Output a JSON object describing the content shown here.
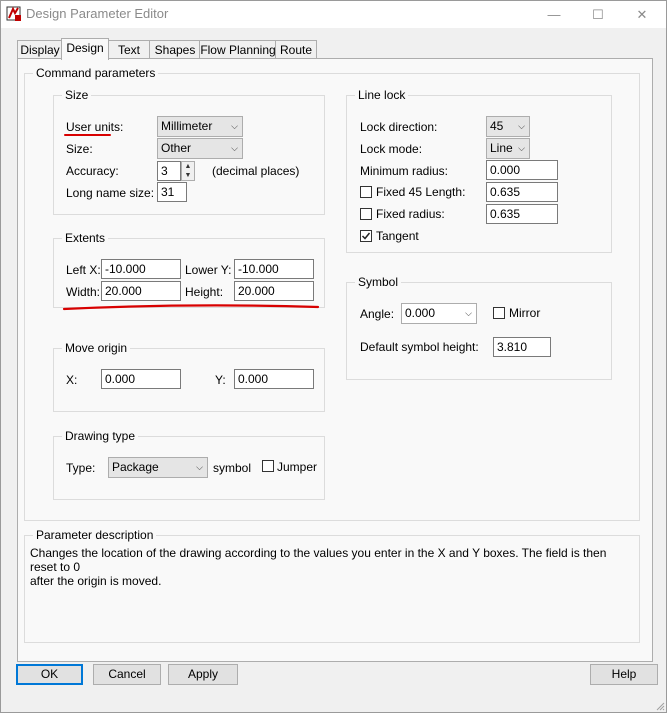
{
  "window": {
    "title": "Design Parameter Editor",
    "minimize_glyph": "—",
    "maximize_glyph": "☐",
    "close_glyph": "✕"
  },
  "tabs": [
    {
      "label": "Display"
    },
    {
      "label": "Design"
    },
    {
      "label": "Text"
    },
    {
      "label": "Shapes"
    },
    {
      "label": "Flow Planning"
    },
    {
      "label": "Route"
    }
  ],
  "active_tab": "Design",
  "command_parameters": {
    "title": "Command parameters",
    "size": {
      "title": "Size",
      "user_units_label": "User units:",
      "user_units_value": "Millimeter",
      "size_label": "Size:",
      "size_value": "Other",
      "accuracy_label": "Accuracy:",
      "accuracy_value": "3",
      "accuracy_suffix": "(decimal places)",
      "long_name_label": "Long name size:",
      "long_name_value": "31"
    },
    "extents": {
      "title": "Extents",
      "left_x_label": "Left X:",
      "left_x_value": "-10.000",
      "lower_y_label": "Lower Y:",
      "lower_y_value": "-10.000",
      "width_label": "Width:",
      "width_value": "20.000",
      "height_label": "Height:",
      "height_value": "20.000"
    },
    "move_origin": {
      "title": "Move origin",
      "x_label": "X:",
      "x_value": "0.000",
      "y_label": "Y:",
      "y_value": "0.000"
    },
    "drawing_type": {
      "title": "Drawing type",
      "type_label": "Type:",
      "type_value": "Package",
      "type_suffix": "symbol",
      "jumper_label": "Jumper",
      "jumper_checked": false
    },
    "line_lock": {
      "title": "Line lock",
      "lock_direction_label": "Lock direction:",
      "lock_direction_value": "45",
      "lock_mode_label": "Lock mode:",
      "lock_mode_value": "Line",
      "min_radius_label": "Minimum radius:",
      "min_radius_value": "0.000",
      "fixed45_label": "Fixed 45 Length:",
      "fixed45_value": "0.635",
      "fixed45_checked": false,
      "fixed_radius_label": "Fixed radius:",
      "fixed_radius_value": "0.635",
      "fixed_radius_checked": false,
      "tangent_label": "Tangent",
      "tangent_checked": true
    },
    "symbol": {
      "title": "Symbol",
      "angle_label": "Angle:",
      "angle_value": "0.000",
      "mirror_label": "Mirror",
      "mirror_checked": false,
      "default_height_label": "Default symbol height:",
      "default_height_value": "3.810"
    }
  },
  "parameter_description": {
    "title": "Parameter description",
    "line1": "Changes the location of the drawing according to the values you enter in the X and Y boxes. The field is then reset to 0",
    "line2": "after the origin is moved."
  },
  "buttons": {
    "ok": "OK",
    "cancel": "Cancel",
    "apply": "Apply",
    "help": "Help"
  },
  "annotation_color": "#d80000",
  "accent_color": "#0078d7"
}
